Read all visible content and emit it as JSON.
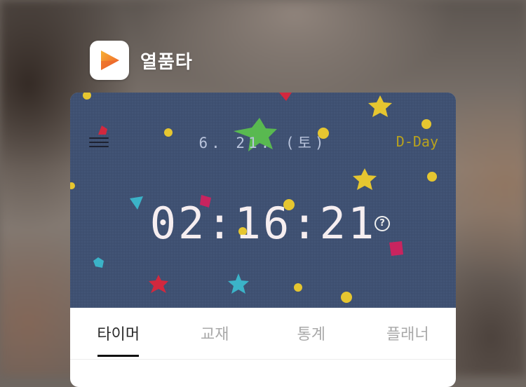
{
  "app": {
    "name": "열품타",
    "icon": "play-logo-icon",
    "brand_colors": [
      "#f7b233",
      "#ef5a2a"
    ]
  },
  "screen": {
    "date": "6. 21. (토)",
    "dday_label": "D-Day",
    "timer": "02:16:21",
    "help_icon": "question-circle-icon",
    "menu_icon": "hamburger-menu-icon",
    "background": "navy-felt-with-glitter-stickers",
    "colors": {
      "hero": "#3e5070",
      "date": "#b9c4dc",
      "dday": "#b9a21d",
      "timer": "#f6eef0"
    }
  },
  "tabs": [
    {
      "label": "타이머",
      "active": true
    },
    {
      "label": "교재",
      "active": false
    },
    {
      "label": "통계",
      "active": false
    },
    {
      "label": "플래너",
      "active": false
    }
  ]
}
